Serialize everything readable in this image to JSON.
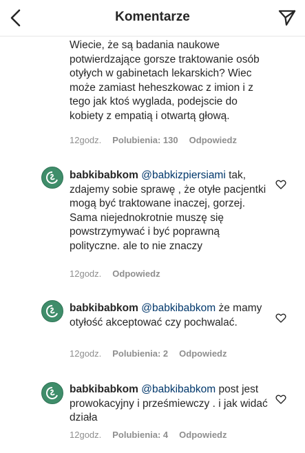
{
  "header": {
    "title": "Komentarze",
    "back_icon": "chevron-left-icon",
    "share_icon": "paper-plane-icon"
  },
  "comments": [
    {
      "text": "Wiecie, że są badania naukowe potwierdzające gorsze traktowanie osób otyłych w gabinetach lekarskich? Wiec może zamiast heheszkowac z imion i z tego jak ktoś wyglada, podejscie do kobiety z empatią i otwartą głową.",
      "time": "12godz.",
      "likes": "Polubienia: 130",
      "reply": "Odpowiedz"
    },
    {
      "user": "babkibabkom",
      "mention": "@babkizpiersiami",
      "text": "tak, zdajemy sobie sprawę , że otyłe pacjentki mogą być traktowane inaczej, gorzej. Sama niejednokrotnie muszę się powstrzymywać i być poprawną polityczne. ale to nie znaczy",
      "time": "12godz.",
      "reply": "Odpowiedz"
    },
    {
      "user": "babkibabkom",
      "mention": "@babkibabkom",
      "text": "że mamy otyłość akceptować czy pochwalać.",
      "time": "12godz.",
      "likes": "Polubienia: 2",
      "reply": "Odpowiedz"
    },
    {
      "user": "babkibabkom",
      "mention": "@babkibabkom",
      "text": "post jest prowokacyjny i prześmiewczy . i jak widać działa",
      "time": "12godz.",
      "likes": "Polubienia: 4",
      "reply": "Odpowiedz"
    }
  ],
  "colors": {
    "text": "#262626",
    "meta": "#8e8e8e",
    "mention": "#00376b",
    "avatar": "#3f8d6a"
  }
}
